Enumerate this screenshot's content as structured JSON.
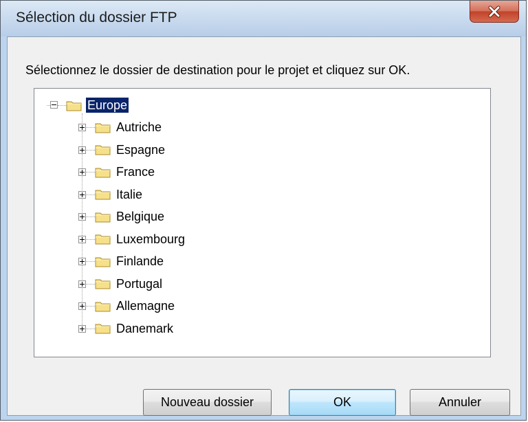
{
  "dialog": {
    "title": "Sélection du dossier FTP",
    "prompt": "Sélectionnez le dossier de destination pour le projet et cliquez sur OK."
  },
  "tree": {
    "root": {
      "label": "Europe",
      "expanded": true,
      "selected": true
    },
    "children": [
      {
        "label": "Autriche"
      },
      {
        "label": "Espagne"
      },
      {
        "label": "France"
      },
      {
        "label": "Italie"
      },
      {
        "label": "Belgique"
      },
      {
        "label": "Luxembourg"
      },
      {
        "label": "Finlande"
      },
      {
        "label": "Portugal"
      },
      {
        "label": "Allemagne"
      },
      {
        "label": "Danemark"
      }
    ]
  },
  "buttons": {
    "new_folder": "Nouveau dossier",
    "ok": "OK",
    "cancel": "Annuler"
  },
  "icons": {
    "close": "close-icon",
    "folder": "folder-icon",
    "expand": "plus-expander-icon",
    "collapse": "minus-expander-icon"
  },
  "colors": {
    "selection": "#0a246a",
    "close_button": "#c1432a",
    "folder": "#f7e08a"
  }
}
